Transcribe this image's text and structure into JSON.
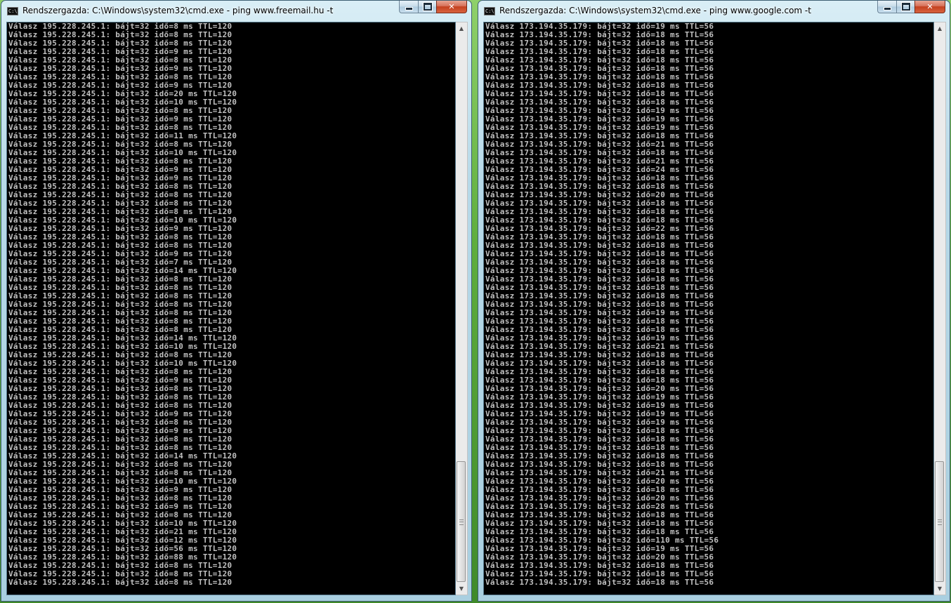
{
  "windows": [
    {
      "title": "Rendszergazda: C:\\Windows\\system32\\cmd.exe - ping  www.freemail.hu -t",
      "icon": "cmd-app-icon",
      "icon_label": "C:\\",
      "buttons": {
        "minimize": "minimize",
        "maximize": "maximize",
        "close": "close"
      },
      "lines": [
        "Válasz 195.228.245.1: bájt=32 idő=8 ms TTL=120",
        "Válasz 195.228.245.1: bájt=32 idő=8 ms TTL=120",
        "Válasz 195.228.245.1: bájt=32 idő=8 ms TTL=120",
        "Válasz 195.228.245.1: bájt=32 idő=9 ms TTL=120",
        "Válasz 195.228.245.1: bájt=32 idő=8 ms TTL=120",
        "Válasz 195.228.245.1: bájt=32 idő=9 ms TTL=120",
        "Válasz 195.228.245.1: bájt=32 idő=8 ms TTL=120",
        "Válasz 195.228.245.1: bájt=32 idő=9 ms TTL=120",
        "Válasz 195.228.245.1: bájt=32 idő=20 ms TTL=120",
        "Válasz 195.228.245.1: bájt=32 idő=10 ms TTL=120",
        "Válasz 195.228.245.1: bájt=32 idő=8 ms TTL=120",
        "Válasz 195.228.245.1: bájt=32 idő=9 ms TTL=120",
        "Válasz 195.228.245.1: bájt=32 idő=8 ms TTL=120",
        "Válasz 195.228.245.1: bájt=32 idő=11 ms TTL=120",
        "Válasz 195.228.245.1: bájt=32 idő=8 ms TTL=120",
        "Válasz 195.228.245.1: bájt=32 idő=10 ms TTL=120",
        "Válasz 195.228.245.1: bájt=32 idő=8 ms TTL=120",
        "Válasz 195.228.245.1: bájt=32 idő=9 ms TTL=120",
        "Válasz 195.228.245.1: bájt=32 idő=9 ms TTL=120",
        "Válasz 195.228.245.1: bájt=32 idő=8 ms TTL=120",
        "Válasz 195.228.245.1: bájt=32 idő=8 ms TTL=120",
        "Válasz 195.228.245.1: bájt=32 idő=8 ms TTL=120",
        "Válasz 195.228.245.1: bájt=32 idő=8 ms TTL=120",
        "Válasz 195.228.245.1: bájt=32 idő=10 ms TTL=120",
        "Válasz 195.228.245.1: bájt=32 idő=9 ms TTL=120",
        "Válasz 195.228.245.1: bájt=32 idő=8 ms TTL=120",
        "Válasz 195.228.245.1: bájt=32 idő=8 ms TTL=120",
        "Válasz 195.228.245.1: bájt=32 idő=9 ms TTL=120",
        "Válasz 195.228.245.1: bájt=32 idő=7 ms TTL=120",
        "Válasz 195.228.245.1: bájt=32 idő=14 ms TTL=120",
        "Válasz 195.228.245.1: bájt=32 idő=8 ms TTL=120",
        "Válasz 195.228.245.1: bájt=32 idő=8 ms TTL=120",
        "Válasz 195.228.245.1: bájt=32 idő=8 ms TTL=120",
        "Válasz 195.228.245.1: bájt=32 idő=8 ms TTL=120",
        "Válasz 195.228.245.1: bájt=32 idő=8 ms TTL=120",
        "Válasz 195.228.245.1: bájt=32 idő=8 ms TTL=120",
        "Válasz 195.228.245.1: bájt=32 idő=8 ms TTL=120",
        "Válasz 195.228.245.1: bájt=32 idő=14 ms TTL=120",
        "Válasz 195.228.245.1: bájt=32 idő=10 ms TTL=120",
        "Válasz 195.228.245.1: bájt=32 idő=8 ms TTL=120",
        "Válasz 195.228.245.1: bájt=32 idő=10 ms TTL=120",
        "Válasz 195.228.245.1: bájt=32 idő=8 ms TTL=120",
        "Válasz 195.228.245.1: bájt=32 idő=9 ms TTL=120",
        "Válasz 195.228.245.1: bájt=32 idő=8 ms TTL=120",
        "Válasz 195.228.245.1: bájt=32 idő=8 ms TTL=120",
        "Válasz 195.228.245.1: bájt=32 idő=8 ms TTL=120",
        "Válasz 195.228.245.1: bájt=32 idő=9 ms TTL=120",
        "Válasz 195.228.245.1: bájt=32 idő=8 ms TTL=120",
        "Válasz 195.228.245.1: bájt=32 idő=9 ms TTL=120",
        "Válasz 195.228.245.1: bájt=32 idő=8 ms TTL=120",
        "Válasz 195.228.245.1: bájt=32 idő=8 ms TTL=120",
        "Válasz 195.228.245.1: bájt=32 idő=14 ms TTL=120",
        "Válasz 195.228.245.1: bájt=32 idő=8 ms TTL=120",
        "Válasz 195.228.245.1: bájt=32 idő=8 ms TTL=120",
        "Válasz 195.228.245.1: bájt=32 idő=10 ms TTL=120",
        "Válasz 195.228.245.1: bájt=32 idő=9 ms TTL=120",
        "Válasz 195.228.245.1: bájt=32 idő=8 ms TTL=120",
        "Válasz 195.228.245.1: bájt=32 idő=9 ms TTL=120",
        "Válasz 195.228.245.1: bájt=32 idő=8 ms TTL=120",
        "Válasz 195.228.245.1: bájt=32 idő=10 ms TTL=120",
        "Válasz 195.228.245.1: bájt=32 idő=21 ms TTL=120",
        "Válasz 195.228.245.1: bájt=32 idő=12 ms TTL=120",
        "Válasz 195.228.245.1: bájt=32 idő=56 ms TTL=120",
        "Válasz 195.228.245.1: bájt=32 idő=88 ms TTL=120",
        "Válasz 195.228.245.1: bájt=32 idő=8 ms TTL=120",
        "Válasz 195.228.245.1: bájt=32 idő=8 ms TTL=120",
        "Válasz 195.228.245.1: bájt=32 idő=8 ms TTL=120"
      ]
    },
    {
      "title": "Rendszergazda: C:\\Windows\\system32\\cmd.exe - ping  www.google.com -t",
      "icon": "cmd-app-icon",
      "icon_label": "C:\\",
      "buttons": {
        "minimize": "minimize",
        "maximize": "maximize",
        "close": "close"
      },
      "lines": [
        "Válasz 173.194.35.179: bájt=32 idő=19 ms TTL=56",
        "Válasz 173.194.35.179: bájt=32 idő=18 ms TTL=56",
        "Válasz 173.194.35.179: bájt=32 idő=18 ms TTL=56",
        "Válasz 173.194.35.179: bájt=32 idő=18 ms TTL=56",
        "Válasz 173.194.35.179: bájt=32 idő=18 ms TTL=56",
        "Válasz 173.194.35.179: bájt=32 idő=18 ms TTL=56",
        "Válasz 173.194.35.179: bájt=32 idő=18 ms TTL=56",
        "Válasz 173.194.35.179: bájt=32 idő=18 ms TTL=56",
        "Válasz 173.194.35.179: bájt=32 idő=18 ms TTL=56",
        "Válasz 173.194.35.179: bájt=32 idő=18 ms TTL=56",
        "Válasz 173.194.35.179: bájt=32 idő=19 ms TTL=56",
        "Válasz 173.194.35.179: bájt=32 idő=19 ms TTL=56",
        "Válasz 173.194.35.179: bájt=32 idő=19 ms TTL=56",
        "Válasz 173.194.35.179: bájt=32 idő=18 ms TTL=56",
        "Válasz 173.194.35.179: bájt=32 idő=21 ms TTL=56",
        "Válasz 173.194.35.179: bájt=32 idő=18 ms TTL=56",
        "Válasz 173.194.35.179: bájt=32 idő=21 ms TTL=56",
        "Válasz 173.194.35.179: bájt=32 idő=24 ms TTL=56",
        "Válasz 173.194.35.179: bájt=32 idő=18 ms TTL=56",
        "Válasz 173.194.35.179: bájt=32 idő=18 ms TTL=56",
        "Válasz 173.194.35.179: bájt=32 idő=20 ms TTL=56",
        "Válasz 173.194.35.179: bájt=32 idő=18 ms TTL=56",
        "Válasz 173.194.35.179: bájt=32 idő=18 ms TTL=56",
        "Válasz 173.194.35.179: bájt=32 idő=18 ms TTL=56",
        "Válasz 173.194.35.179: bájt=32 idő=22 ms TTL=56",
        "Válasz 173.194.35.179: bájt=32 idő=18 ms TTL=56",
        "Válasz 173.194.35.179: bájt=32 idő=18 ms TTL=56",
        "Válasz 173.194.35.179: bájt=32 idő=18 ms TTL=56",
        "Válasz 173.194.35.179: bájt=32 idő=18 ms TTL=56",
        "Válasz 173.194.35.179: bájt=32 idő=18 ms TTL=56",
        "Válasz 173.194.35.179: bájt=32 idő=18 ms TTL=56",
        "Válasz 173.194.35.179: bájt=32 idő=18 ms TTL=56",
        "Válasz 173.194.35.179: bájt=32 idő=18 ms TTL=56",
        "Válasz 173.194.35.179: bájt=32 idő=18 ms TTL=56",
        "Válasz 173.194.35.179: bájt=32 idő=19 ms TTL=56",
        "Válasz 173.194.35.179: bájt=32 idő=18 ms TTL=56",
        "Válasz 173.194.35.179: bájt=32 idő=18 ms TTL=56",
        "Válasz 173.194.35.179: bájt=32 idő=19 ms TTL=56",
        "Válasz 173.194.35.179: bájt=32 idő=21 ms TTL=56",
        "Válasz 173.194.35.179: bájt=32 idő=18 ms TTL=56",
        "Válasz 173.194.35.179: bájt=32 idő=18 ms TTL=56",
        "Válasz 173.194.35.179: bájt=32 idő=18 ms TTL=56",
        "Válasz 173.194.35.179: bájt=32 idő=18 ms TTL=56",
        "Válasz 173.194.35.179: bájt=32 idő=20 ms TTL=56",
        "Válasz 173.194.35.179: bájt=32 idő=19 ms TTL=56",
        "Válasz 173.194.35.179: bájt=32 idő=19 ms TTL=56",
        "Válasz 173.194.35.179: bájt=32 idő=19 ms TTL=56",
        "Válasz 173.194.35.179: bájt=32 idő=19 ms TTL=56",
        "Válasz 173.194.35.179: bájt=32 idő=18 ms TTL=56",
        "Válasz 173.194.35.179: bájt=32 idő=18 ms TTL=56",
        "Válasz 173.194.35.179: bájt=32 idő=18 ms TTL=56",
        "Válasz 173.194.35.179: bájt=32 idő=18 ms TTL=56",
        "Válasz 173.194.35.179: bájt=32 idő=18 ms TTL=56",
        "Válasz 173.194.35.179: bájt=32 idő=21 ms TTL=56",
        "Válasz 173.194.35.179: bájt=32 idő=20 ms TTL=56",
        "Válasz 173.194.35.179: bájt=32 idő=18 ms TTL=56",
        "Válasz 173.194.35.179: bájt=32 idő=20 ms TTL=56",
        "Válasz 173.194.35.179: bájt=32 idő=28 ms TTL=56",
        "Válasz 173.194.35.179: bájt=32 idő=18 ms TTL=56",
        "Válasz 173.194.35.179: bájt=32 idő=18 ms TTL=56",
        "Válasz 173.194.35.179: bájt=32 idő=18 ms TTL=56",
        "Válasz 173.194.35.179: bájt=32 idő=110 ms TTL=56",
        "Válasz 173.194.35.179: bájt=32 idő=19 ms TTL=56",
        "Válasz 173.194.35.179: bájt=32 idő=20 ms TTL=56",
        "Válasz 173.194.35.179: bájt=32 idő=18 ms TTL=56",
        "Válasz 173.194.35.179: bájt=32 idő=18 ms TTL=56",
        "Válasz 173.194.35.179: bájt=32 idő=18 ms TTL=56"
      ]
    }
  ]
}
